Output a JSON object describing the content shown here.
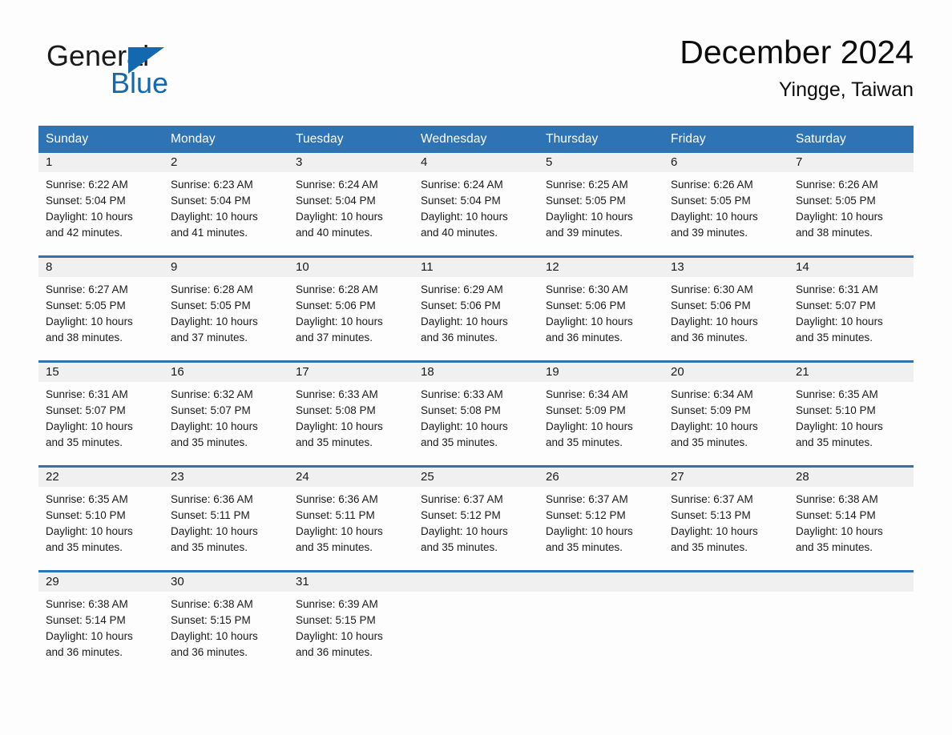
{
  "brand": {
    "line1": "General",
    "line2": "Blue",
    "mark": "triangle-logo",
    "accent_blue": "#1269b0"
  },
  "header": {
    "title": "December 2024",
    "subtitle": "Yingge, Taiwan"
  },
  "theme": {
    "header_blue": "#2e74b5",
    "daynum_band": "#f0f0f0",
    "page_background": "#fdfdfd",
    "text": "#1a1a1a"
  },
  "calendar": {
    "weekdays": [
      "Sunday",
      "Monday",
      "Tuesday",
      "Wednesday",
      "Thursday",
      "Friday",
      "Saturday"
    ],
    "weeks": [
      [
        {
          "day": "1",
          "l1": "Sunrise: 6:22 AM",
          "l2": "Sunset: 5:04 PM",
          "l3": "Daylight: 10 hours",
          "l4": "and 42 minutes."
        },
        {
          "day": "2",
          "l1": "Sunrise: 6:23 AM",
          "l2": "Sunset: 5:04 PM",
          "l3": "Daylight: 10 hours",
          "l4": "and 41 minutes."
        },
        {
          "day": "3",
          "l1": "Sunrise: 6:24 AM",
          "l2": "Sunset: 5:04 PM",
          "l3": "Daylight: 10 hours",
          "l4": "and 40 minutes."
        },
        {
          "day": "4",
          "l1": "Sunrise: 6:24 AM",
          "l2": "Sunset: 5:04 PM",
          "l3": "Daylight: 10 hours",
          "l4": "and 40 minutes."
        },
        {
          "day": "5",
          "l1": "Sunrise: 6:25 AM",
          "l2": "Sunset: 5:05 PM",
          "l3": "Daylight: 10 hours",
          "l4": "and 39 minutes."
        },
        {
          "day": "6",
          "l1": "Sunrise: 6:26 AM",
          "l2": "Sunset: 5:05 PM",
          "l3": "Daylight: 10 hours",
          "l4": "and 39 minutes."
        },
        {
          "day": "7",
          "l1": "Sunrise: 6:26 AM",
          "l2": "Sunset: 5:05 PM",
          "l3": "Daylight: 10 hours",
          "l4": "and 38 minutes."
        }
      ],
      [
        {
          "day": "8",
          "l1": "Sunrise: 6:27 AM",
          "l2": "Sunset: 5:05 PM",
          "l3": "Daylight: 10 hours",
          "l4": "and 38 minutes."
        },
        {
          "day": "9",
          "l1": "Sunrise: 6:28 AM",
          "l2": "Sunset: 5:05 PM",
          "l3": "Daylight: 10 hours",
          "l4": "and 37 minutes."
        },
        {
          "day": "10",
          "l1": "Sunrise: 6:28 AM",
          "l2": "Sunset: 5:06 PM",
          "l3": "Daylight: 10 hours",
          "l4": "and 37 minutes."
        },
        {
          "day": "11",
          "l1": "Sunrise: 6:29 AM",
          "l2": "Sunset: 5:06 PM",
          "l3": "Daylight: 10 hours",
          "l4": "and 36 minutes."
        },
        {
          "day": "12",
          "l1": "Sunrise: 6:30 AM",
          "l2": "Sunset: 5:06 PM",
          "l3": "Daylight: 10 hours",
          "l4": "and 36 minutes."
        },
        {
          "day": "13",
          "l1": "Sunrise: 6:30 AM",
          "l2": "Sunset: 5:06 PM",
          "l3": "Daylight: 10 hours",
          "l4": "and 36 minutes."
        },
        {
          "day": "14",
          "l1": "Sunrise: 6:31 AM",
          "l2": "Sunset: 5:07 PM",
          "l3": "Daylight: 10 hours",
          "l4": "and 35 minutes."
        }
      ],
      [
        {
          "day": "15",
          "l1": "Sunrise: 6:31 AM",
          "l2": "Sunset: 5:07 PM",
          "l3": "Daylight: 10 hours",
          "l4": "and 35 minutes."
        },
        {
          "day": "16",
          "l1": "Sunrise: 6:32 AM",
          "l2": "Sunset: 5:07 PM",
          "l3": "Daylight: 10 hours",
          "l4": "and 35 minutes."
        },
        {
          "day": "17",
          "l1": "Sunrise: 6:33 AM",
          "l2": "Sunset: 5:08 PM",
          "l3": "Daylight: 10 hours",
          "l4": "and 35 minutes."
        },
        {
          "day": "18",
          "l1": "Sunrise: 6:33 AM",
          "l2": "Sunset: 5:08 PM",
          "l3": "Daylight: 10 hours",
          "l4": "and 35 minutes."
        },
        {
          "day": "19",
          "l1": "Sunrise: 6:34 AM",
          "l2": "Sunset: 5:09 PM",
          "l3": "Daylight: 10 hours",
          "l4": "and 35 minutes."
        },
        {
          "day": "20",
          "l1": "Sunrise: 6:34 AM",
          "l2": "Sunset: 5:09 PM",
          "l3": "Daylight: 10 hours",
          "l4": "and 35 minutes."
        },
        {
          "day": "21",
          "l1": "Sunrise: 6:35 AM",
          "l2": "Sunset: 5:10 PM",
          "l3": "Daylight: 10 hours",
          "l4": "and 35 minutes."
        }
      ],
      [
        {
          "day": "22",
          "l1": "Sunrise: 6:35 AM",
          "l2": "Sunset: 5:10 PM",
          "l3": "Daylight: 10 hours",
          "l4": "and 35 minutes."
        },
        {
          "day": "23",
          "l1": "Sunrise: 6:36 AM",
          "l2": "Sunset: 5:11 PM",
          "l3": "Daylight: 10 hours",
          "l4": "and 35 minutes."
        },
        {
          "day": "24",
          "l1": "Sunrise: 6:36 AM",
          "l2": "Sunset: 5:11 PM",
          "l3": "Daylight: 10 hours",
          "l4": "and 35 minutes."
        },
        {
          "day": "25",
          "l1": "Sunrise: 6:37 AM",
          "l2": "Sunset: 5:12 PM",
          "l3": "Daylight: 10 hours",
          "l4": "and 35 minutes."
        },
        {
          "day": "26",
          "l1": "Sunrise: 6:37 AM",
          "l2": "Sunset: 5:12 PM",
          "l3": "Daylight: 10 hours",
          "l4": "and 35 minutes."
        },
        {
          "day": "27",
          "l1": "Sunrise: 6:37 AM",
          "l2": "Sunset: 5:13 PM",
          "l3": "Daylight: 10 hours",
          "l4": "and 35 minutes."
        },
        {
          "day": "28",
          "l1": "Sunrise: 6:38 AM",
          "l2": "Sunset: 5:14 PM",
          "l3": "Daylight: 10 hours",
          "l4": "and 35 minutes."
        }
      ],
      [
        {
          "day": "29",
          "l1": "Sunrise: 6:38 AM",
          "l2": "Sunset: 5:14 PM",
          "l3": "Daylight: 10 hours",
          "l4": "and 36 minutes."
        },
        {
          "day": "30",
          "l1": "Sunrise: 6:38 AM",
          "l2": "Sunset: 5:15 PM",
          "l3": "Daylight: 10 hours",
          "l4": "and 36 minutes."
        },
        {
          "day": "31",
          "l1": "Sunrise: 6:39 AM",
          "l2": "Sunset: 5:15 PM",
          "l3": "Daylight: 10 hours",
          "l4": "and 36 minutes."
        },
        {
          "day": "",
          "l1": "",
          "l2": "",
          "l3": "",
          "l4": ""
        },
        {
          "day": "",
          "l1": "",
          "l2": "",
          "l3": "",
          "l4": ""
        },
        {
          "day": "",
          "l1": "",
          "l2": "",
          "l3": "",
          "l4": ""
        },
        {
          "day": "",
          "l1": "",
          "l2": "",
          "l3": "",
          "l4": ""
        }
      ]
    ]
  }
}
